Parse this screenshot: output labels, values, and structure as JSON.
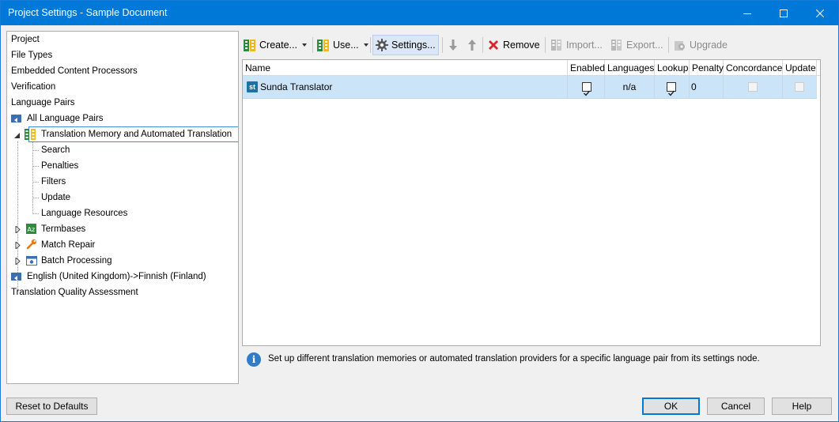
{
  "window": {
    "title": "Project Settings - Sample Document"
  },
  "tree": {
    "items": [
      {
        "label": "Project"
      },
      {
        "label": "File Types"
      },
      {
        "label": "Embedded Content Processors"
      },
      {
        "label": "Verification"
      },
      {
        "label": "Language Pairs"
      },
      {
        "label": "All Language Pairs"
      },
      {
        "label": "Translation Memory and Automated Translation"
      },
      {
        "label": "Search"
      },
      {
        "label": "Penalties"
      },
      {
        "label": "Filters"
      },
      {
        "label": "Update"
      },
      {
        "label": "Language Resources"
      },
      {
        "label": "Termbases"
      },
      {
        "label": "Match Repair"
      },
      {
        "label": "Batch Processing"
      },
      {
        "label": "English (United Kingdom)->Finnish (Finland)"
      },
      {
        "label": "Translation Quality Assessment"
      }
    ]
  },
  "toolbar": {
    "create": "Create...",
    "use": "Use...",
    "settings": "Settings...",
    "remove": "Remove",
    "import": "Import...",
    "export": "Export...",
    "upgrade": "Upgrade"
  },
  "grid": {
    "columns": [
      "Name",
      "Enabled",
      "Languages",
      "Lookup",
      "Penalty",
      "Concordance",
      "Update"
    ],
    "rows": [
      {
        "icon": "st",
        "name": "Sunda Translator",
        "enabled": true,
        "languages": "n/a",
        "lookup": true,
        "penalty": "0",
        "concordance": false,
        "update": false
      }
    ]
  },
  "info": {
    "text": "Set up different translation memories or automated translation providers for a specific language pair from its settings node."
  },
  "buttons": {
    "reset": "Reset to Defaults",
    "ok": "OK",
    "cancel": "Cancel",
    "help": "Help"
  },
  "colors": {
    "title_bar": "#0078d7",
    "selection": "#cce4f7",
    "remove_icon": "#d9242b"
  }
}
